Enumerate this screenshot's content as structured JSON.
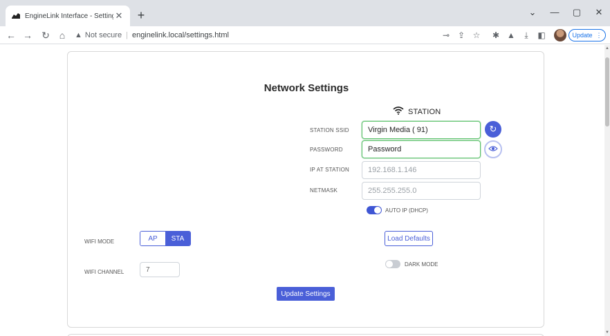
{
  "browser": {
    "tab_title": "EngineLink Interface - Settings",
    "tab_close": "✕",
    "new_tab": "+",
    "window_controls": {
      "collapse": "⌄",
      "minimize": "—",
      "maximize": "▢",
      "close": "✕"
    },
    "nav": {
      "back": "←",
      "forward": "→",
      "reload": "↻",
      "home": "⌂"
    },
    "security_label": "Not secure",
    "separator": "|",
    "url": "enginelink.local/settings.html",
    "update_label": "Update",
    "update_menu": "⋮"
  },
  "page": {
    "title": "Network Settings",
    "station_header": "STATION",
    "fields": {
      "ssid": {
        "label": "STATION SSID",
        "value": "Virgin Media ( 91)"
      },
      "password": {
        "label": "PASSWORD",
        "value": "Password"
      },
      "ip": {
        "label": "IP AT STATION",
        "placeholder": "192.168.1.146"
      },
      "netmask": {
        "label": "NETMASK",
        "placeholder": "255.255.255.0"
      }
    },
    "auto_ip": {
      "label": "AUTO IP (DHCP)",
      "on": true
    },
    "wifi_mode": {
      "label": "WIFI MODE",
      "options": [
        "AP",
        "STA"
      ],
      "selected": "STA"
    },
    "wifi_channel": {
      "label": "WIFI CHANNEL",
      "value": "7"
    },
    "load_defaults_label": "Load Defaults",
    "dark_mode": {
      "label": "DARK MODE",
      "on": false
    },
    "update_settings_label": "Update Settings",
    "refresh_glyph": "↻"
  },
  "colors": {
    "accent": "#4a5fd8",
    "focus": "#5ac26a"
  }
}
